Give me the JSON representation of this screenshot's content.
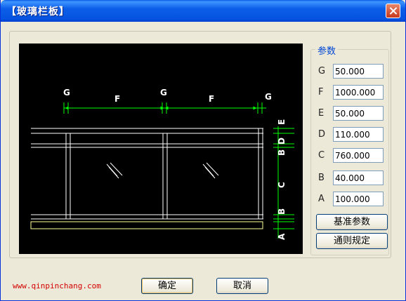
{
  "window": {
    "title": "【玻璃栏板】"
  },
  "drawing": {
    "labels": {
      "g1": "G",
      "f1": "F",
      "g2": "G",
      "f2": "F",
      "g3": "G",
      "e": "E",
      "d": "D",
      "c": "C",
      "b1": "B",
      "b2": "B",
      "a": "A"
    },
    "line_color": "#ffffff",
    "dim_color": "#00ff00",
    "accent_color": "#ffff99"
  },
  "params": {
    "legend": "参数",
    "fields": [
      {
        "label": "G",
        "value": "50.000"
      },
      {
        "label": "F",
        "value": "1000.000"
      },
      {
        "label": "E",
        "value": "50.000"
      },
      {
        "label": "D",
        "value": "110.000"
      },
      {
        "label": "C",
        "value": "760.000"
      },
      {
        "label": "B",
        "value": "40.000"
      },
      {
        "label": "A",
        "value": "100.000"
      }
    ],
    "base_params_button": "基准参数",
    "general_rules_button": "通则规定"
  },
  "footer": {
    "website": "www.qinpinchang.com",
    "ok_button": "确定",
    "cancel_button": "取消"
  }
}
